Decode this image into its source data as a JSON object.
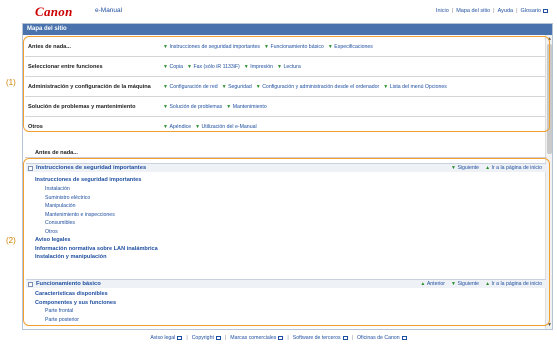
{
  "header": {
    "logo": "Canon",
    "product": "e-Manual",
    "links": [
      "Inicio",
      "Mapa del sitio",
      "Ayuda",
      "Glosario"
    ]
  },
  "panel": {
    "title": "Mapa del sitio"
  },
  "sitemap": [
    {
      "category": "Antes de nada...",
      "links": [
        "Instrucciones de seguridad importantes",
        "Funcionamiento básico",
        "Especificaciones"
      ]
    },
    {
      "category": "Seleccionar entre funciones",
      "links": [
        "Copia",
        "Fax (sólo iR 1133iF)",
        "Impresión",
        "Lectura"
      ]
    },
    {
      "category": "Administración y configuración de la máquina",
      "links": [
        "Configuración de red",
        "Seguridad",
        "Configuración y administración desde el ordenador",
        "Lista del menú Opciones"
      ]
    },
    {
      "category": "Solución de problemas y mantenimiento",
      "links": [
        "Solución de problemas",
        "Mantenimiento"
      ]
    },
    {
      "category": "Otros",
      "links": [
        "Apéndice",
        "Utilización del e-Manual"
      ]
    }
  ],
  "callouts": [
    "(1)",
    "(2)"
  ],
  "antes_heading": "Antes de nada...",
  "section1": {
    "title": "Instrucciones de seguridad importantes",
    "nav": [
      "Siguiente",
      "Ir a la página de inicio"
    ],
    "items": [
      {
        "text": "Instrucciones de seguridad importantes",
        "level": 0
      },
      {
        "text": "Instalación",
        "level": 1
      },
      {
        "text": "Suministro eléctrico",
        "level": 1
      },
      {
        "text": "Manipulación",
        "level": 1
      },
      {
        "text": "Mantenimiento e inspecciones",
        "level": 1
      },
      {
        "text": "Consumibles",
        "level": 1
      },
      {
        "text": "Otros",
        "level": 1
      },
      {
        "text": "Aviso legales",
        "level": 0
      },
      {
        "text": "Información normativa sobre LAN inalámbrica",
        "level": 0
      },
      {
        "text": "Instalación y manipulación",
        "level": 0
      }
    ]
  },
  "section2": {
    "title": "Funcionamiento básico",
    "nav": [
      "Anterior",
      "Siguiente",
      "Ir a la página de inicio"
    ],
    "items": [
      {
        "text": "Características disponibles",
        "level": 0
      },
      {
        "text": "Componentes y sus funciones",
        "level": 0
      },
      {
        "text": "Parte frontal",
        "level": 1
      },
      {
        "text": "Parte posterior",
        "level": 1
      }
    ]
  },
  "footer": [
    "Aviso legal",
    "Copyright",
    "Marcas comerciales",
    "Software de terceros",
    "Oficinas de Canon"
  ],
  "colors": {
    "accent": "#4a73ad",
    "link": "#1f4fa0",
    "highlight": "#f0a030",
    "logo": "#cc0000"
  }
}
